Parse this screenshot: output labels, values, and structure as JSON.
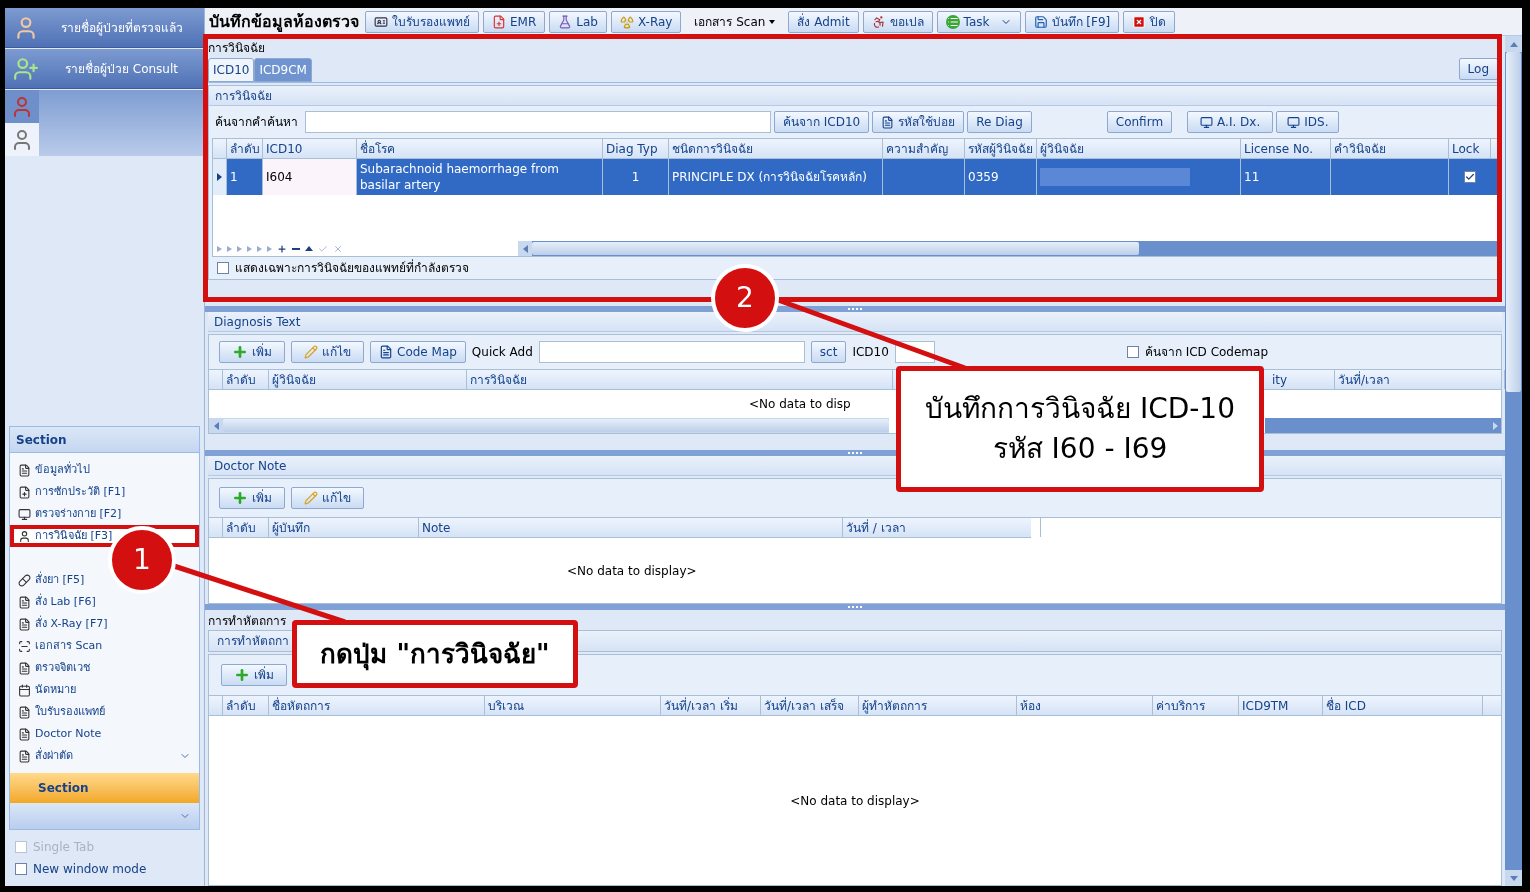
{
  "sidebar": {
    "patient_lists": [
      {
        "label": "รายชื่อผู้ป่วยที่ตรวจแล้ว"
      },
      {
        "label": "รายชื่อผู้ป่วย Consult"
      }
    ],
    "section_title": "Section",
    "section_items": [
      {
        "label": "ข้อมูลทั่วไป",
        "selected": false
      },
      {
        "label": "การซักประวัติ [F1]",
        "selected": false
      },
      {
        "label": "ตรวจร่างกาย [F2]",
        "selected": false
      },
      {
        "label": "การวินิจฉัย [F3]",
        "selected": true
      },
      {
        "label": "สั่งยา [F5]",
        "selected": false
      },
      {
        "label": "สั่ง Lab  [F6]",
        "selected": false
      },
      {
        "label": "สั่ง X-Ray  [F7]",
        "selected": false
      },
      {
        "label": "เอกสาร Scan",
        "selected": false
      },
      {
        "label": "ตรวจจิตเวช",
        "selected": false
      },
      {
        "label": "นัดหมาย",
        "selected": false
      },
      {
        "label": "ใบรับรองแพทย์",
        "selected": false
      },
      {
        "label": "Doctor Note",
        "selected": false
      },
      {
        "label": "สั่งผ่าตัด",
        "selected": false
      }
    ],
    "section_button": "Section",
    "options": [
      {
        "label": "Single Tab",
        "checked": false,
        "disabled": true
      },
      {
        "label": "New window mode",
        "checked": false,
        "disabled": false
      }
    ]
  },
  "toolbar": {
    "title": "บันทึกข้อมูลห้องตรวจ",
    "buttons": [
      {
        "label": "ใบรับรองแพทย์",
        "kind": "plain"
      },
      {
        "label": "EMR",
        "kind": "plain"
      },
      {
        "label": "Lab",
        "kind": "plain"
      },
      {
        "label": "X-Ray",
        "kind": "plain"
      },
      {
        "label": "เอกสาร Scan",
        "kind": "menu"
      },
      {
        "label": "สั่ง Admit",
        "kind": "plain"
      },
      {
        "label": "ขอเปล",
        "kind": "plain"
      },
      {
        "label": "Task",
        "kind": "split"
      },
      {
        "label": "บันทึก [F9]",
        "kind": "plain"
      },
      {
        "label": "ปิด",
        "kind": "plain"
      }
    ]
  },
  "diagnosis": {
    "title": "การวินิจฉัย",
    "tabs": [
      {
        "label": "ICD10",
        "selected": true
      },
      {
        "label": "ICD9CM",
        "selected": false
      }
    ],
    "log_button": "Log",
    "group_title": "การวินิจฉัย",
    "search_label": "ค้นจากคำค้นหา",
    "buttons": [
      "ค้นจาก ICD10",
      "รหัสใช้บ่อย",
      "Re Diag",
      "Confirm",
      "A.I. Dx.",
      "IDS."
    ],
    "columns": [
      "ลำดับ",
      "ICD10",
      "ชื่อโรค",
      "Diag Typ",
      "ชนิดการวินิจฉัย",
      "ความสำคัญ",
      "รหัสผู้วินิจฉัย",
      "ผู้วินิจฉัย",
      "License No.",
      "คำวินิจฉัย",
      "Lock"
    ],
    "rows": [
      {
        "no": "1",
        "icd10": "I604",
        "name": "Subarachnoid haemorrhage from basilar artery",
        "diag_type": "1",
        "diag_kind": "PRINCIPLE DX (การวินิจฉัยโรคหลัก)",
        "doctor_code": "0359",
        "license": "11",
        "locked": true,
        "selected": true
      }
    ],
    "filter": {
      "label": "แสดงเฉพาะการวินิจฉัยของแพทย์ที่กำลังตรวจ",
      "checked": false
    }
  },
  "diagnosis_text": {
    "title": "Diagnosis Text",
    "buttons": [
      "เพิ่ม",
      "แก้ไข",
      "Code Map"
    ],
    "quick_add_label": "Quick Add",
    "sct_button": "sct",
    "icd10_label": "ICD10",
    "codemap": {
      "label": "ค้นจาก ICD Codemap",
      "checked": false
    },
    "columns": [
      "ลำดับ",
      "ผู้วินิจฉัย",
      "การวินิจฉัย",
      "ity",
      "วันที่/เวลา"
    ],
    "empty_text": "<No data to disp"
  },
  "doctor_note": {
    "title": "Doctor Note",
    "buttons": [
      "เพิ่ม",
      "แก้ไข"
    ],
    "columns": [
      "ลำดับ",
      "ผู้บันทึก",
      "Note",
      "วันที่ / เวลา"
    ],
    "empty_text": "<No data to display>"
  },
  "procedures": {
    "title": "การทำหัตถการ",
    "tab": "การทำหัตถกา",
    "add_button": "เพิ่ม",
    "columns": [
      "ลำดับ",
      "ชื่อหัตถการ",
      "บริเวณ",
      "วันที่/เวลา เริ่ม",
      "วันที่/เวลา เสร็จ",
      "ผู้ทำหัตถการ",
      "ห้อง",
      "ค่าบริการ",
      "ICD9TM",
      "ชื่อ ICD"
    ],
    "empty_text": "<No data to display>"
  },
  "annotations": [
    {
      "number": "1",
      "lines": [
        "กดปุ่ม \"การวินิจฉัย\""
      ]
    },
    {
      "number": "2",
      "lines": [
        "บันทึกการวินิจฉัย ICD-10",
        "รหัส I60 - I69"
      ]
    }
  ]
}
